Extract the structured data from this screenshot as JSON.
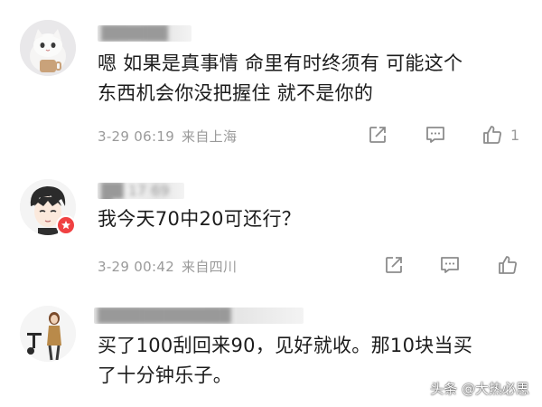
{
  "comments": [
    {
      "username": "██████",
      "text_lines": [
        "嗯 如果是真事情 命里有时终须有 可能这个",
        "东西机会你没把握住 就不是你的"
      ],
      "date": "3-29 06:19",
      "location": "来自上海",
      "likes": "1"
    },
    {
      "username": "██ 17 69 █",
      "text_lines": [
        "我今天70中20可还行？"
      ],
      "date": "3-29 00:42",
      "location": "来自四川",
      "likes": ""
    },
    {
      "username": "████████████",
      "text_lines": [
        "买了100刮回来90，见好就收。那10块当买",
        "了十分钟乐子。"
      ],
      "date": "",
      "location": "",
      "likes": ""
    }
  ],
  "watermark": "头条 @大热必思",
  "icons": {
    "share": "share-icon",
    "reply": "comment-icon",
    "like": "thumbs-up-icon",
    "badge": "verified-badge-icon"
  },
  "colors": {
    "text": "#1c1c1c",
    "meta": "#9a9a9a",
    "badge": "#f04142",
    "icon": "#8c8c8c"
  }
}
